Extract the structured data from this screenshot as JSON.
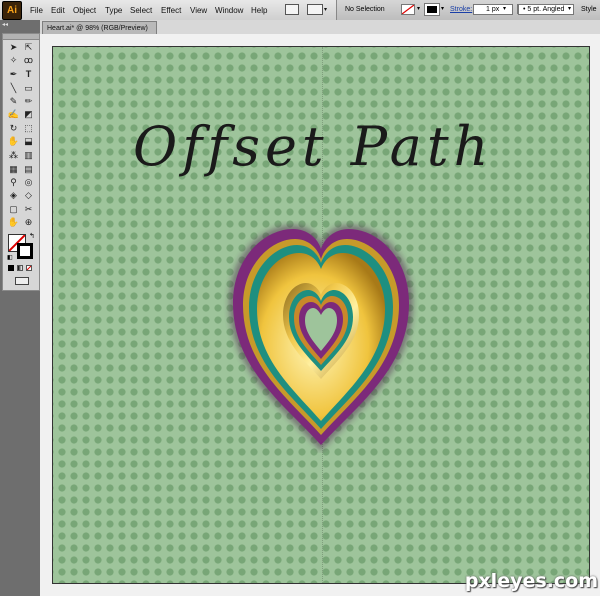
{
  "app": {
    "logo": "Ai"
  },
  "menu": [
    "File",
    "Edit",
    "Object",
    "Type",
    "Select",
    "Effect",
    "View",
    "Window",
    "Help"
  ],
  "control": {
    "selection": "No Selection",
    "stroke_label": "Stroke:",
    "stroke_value": "1 px",
    "brush_value": "5 pt. Angled",
    "style_label": "Style"
  },
  "document_tab": "Heart.ai* @ 98% (RGB/Preview)",
  "tools": [
    "selection",
    "direct-selection",
    "magic-wand",
    "lasso",
    "pen",
    "type",
    "line",
    "rectangle",
    "paintbrush",
    "pencil",
    "blob-brush",
    "eraser",
    "rotate",
    "scale",
    "warp",
    "free-transform",
    "symbol-sprayer",
    "column-graph",
    "mesh",
    "gradient",
    "eyedropper",
    "blend",
    "live-paint",
    "live-paint-select",
    "artboard",
    "slice",
    "hand",
    "zoom"
  ],
  "canvas": {
    "title": "Offset Path",
    "background_color": "#9ec49b",
    "dot_color": "#78a677"
  },
  "heart_colors": [
    "#7c2a7a",
    "#c79a2a",
    "#1e8f80",
    "#ffd84a",
    "#8a6a1e"
  ],
  "watermark": "pxleyes.com"
}
